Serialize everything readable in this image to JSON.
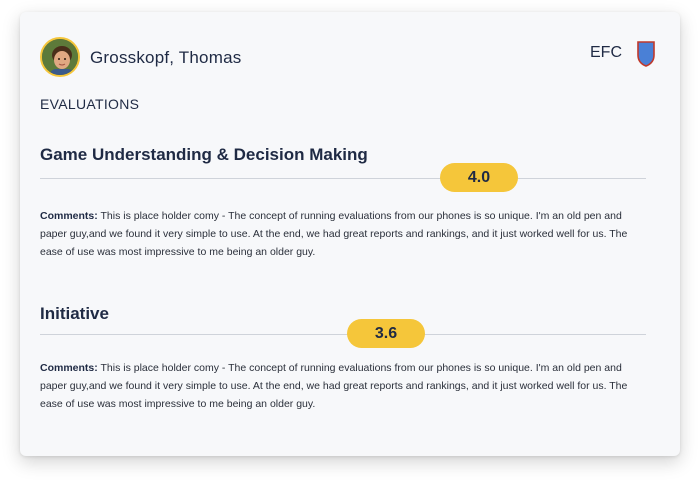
{
  "player": {
    "name": "Grosskopf, Thomas"
  },
  "team": {
    "code": "EFC",
    "crest_color": "#4a80d6"
  },
  "section_heading": "EVALUATIONS",
  "evaluations": [
    {
      "title": "Game Understanding & Decision Making",
      "score": "4.0",
      "comment_label": "Comments:",
      "comment_text": "This is place holder comy - The concept of running evaluations from our phones is so unique. I'm an old pen and paper guy,and we found it very simple to use. At the end, we had great reports and rankings, and it just worked well for us. The ease of use was most impressive to me being an older guy."
    },
    {
      "title": "Initiative",
      "score": "3.6",
      "comment_label": "Comments:",
      "comment_text": "This is place holder comy - The concept of running evaluations from our phones is so unique. I'm an old pen and paper guy,and we found it very simple to use. At the end, we had great reports and rankings, and it just worked well for us. The ease of use was most impressive to me being an older guy."
    }
  ],
  "colors": {
    "accent": "#f5c63a",
    "text": "#1f2a44",
    "card_bg": "#f7f8fa"
  }
}
